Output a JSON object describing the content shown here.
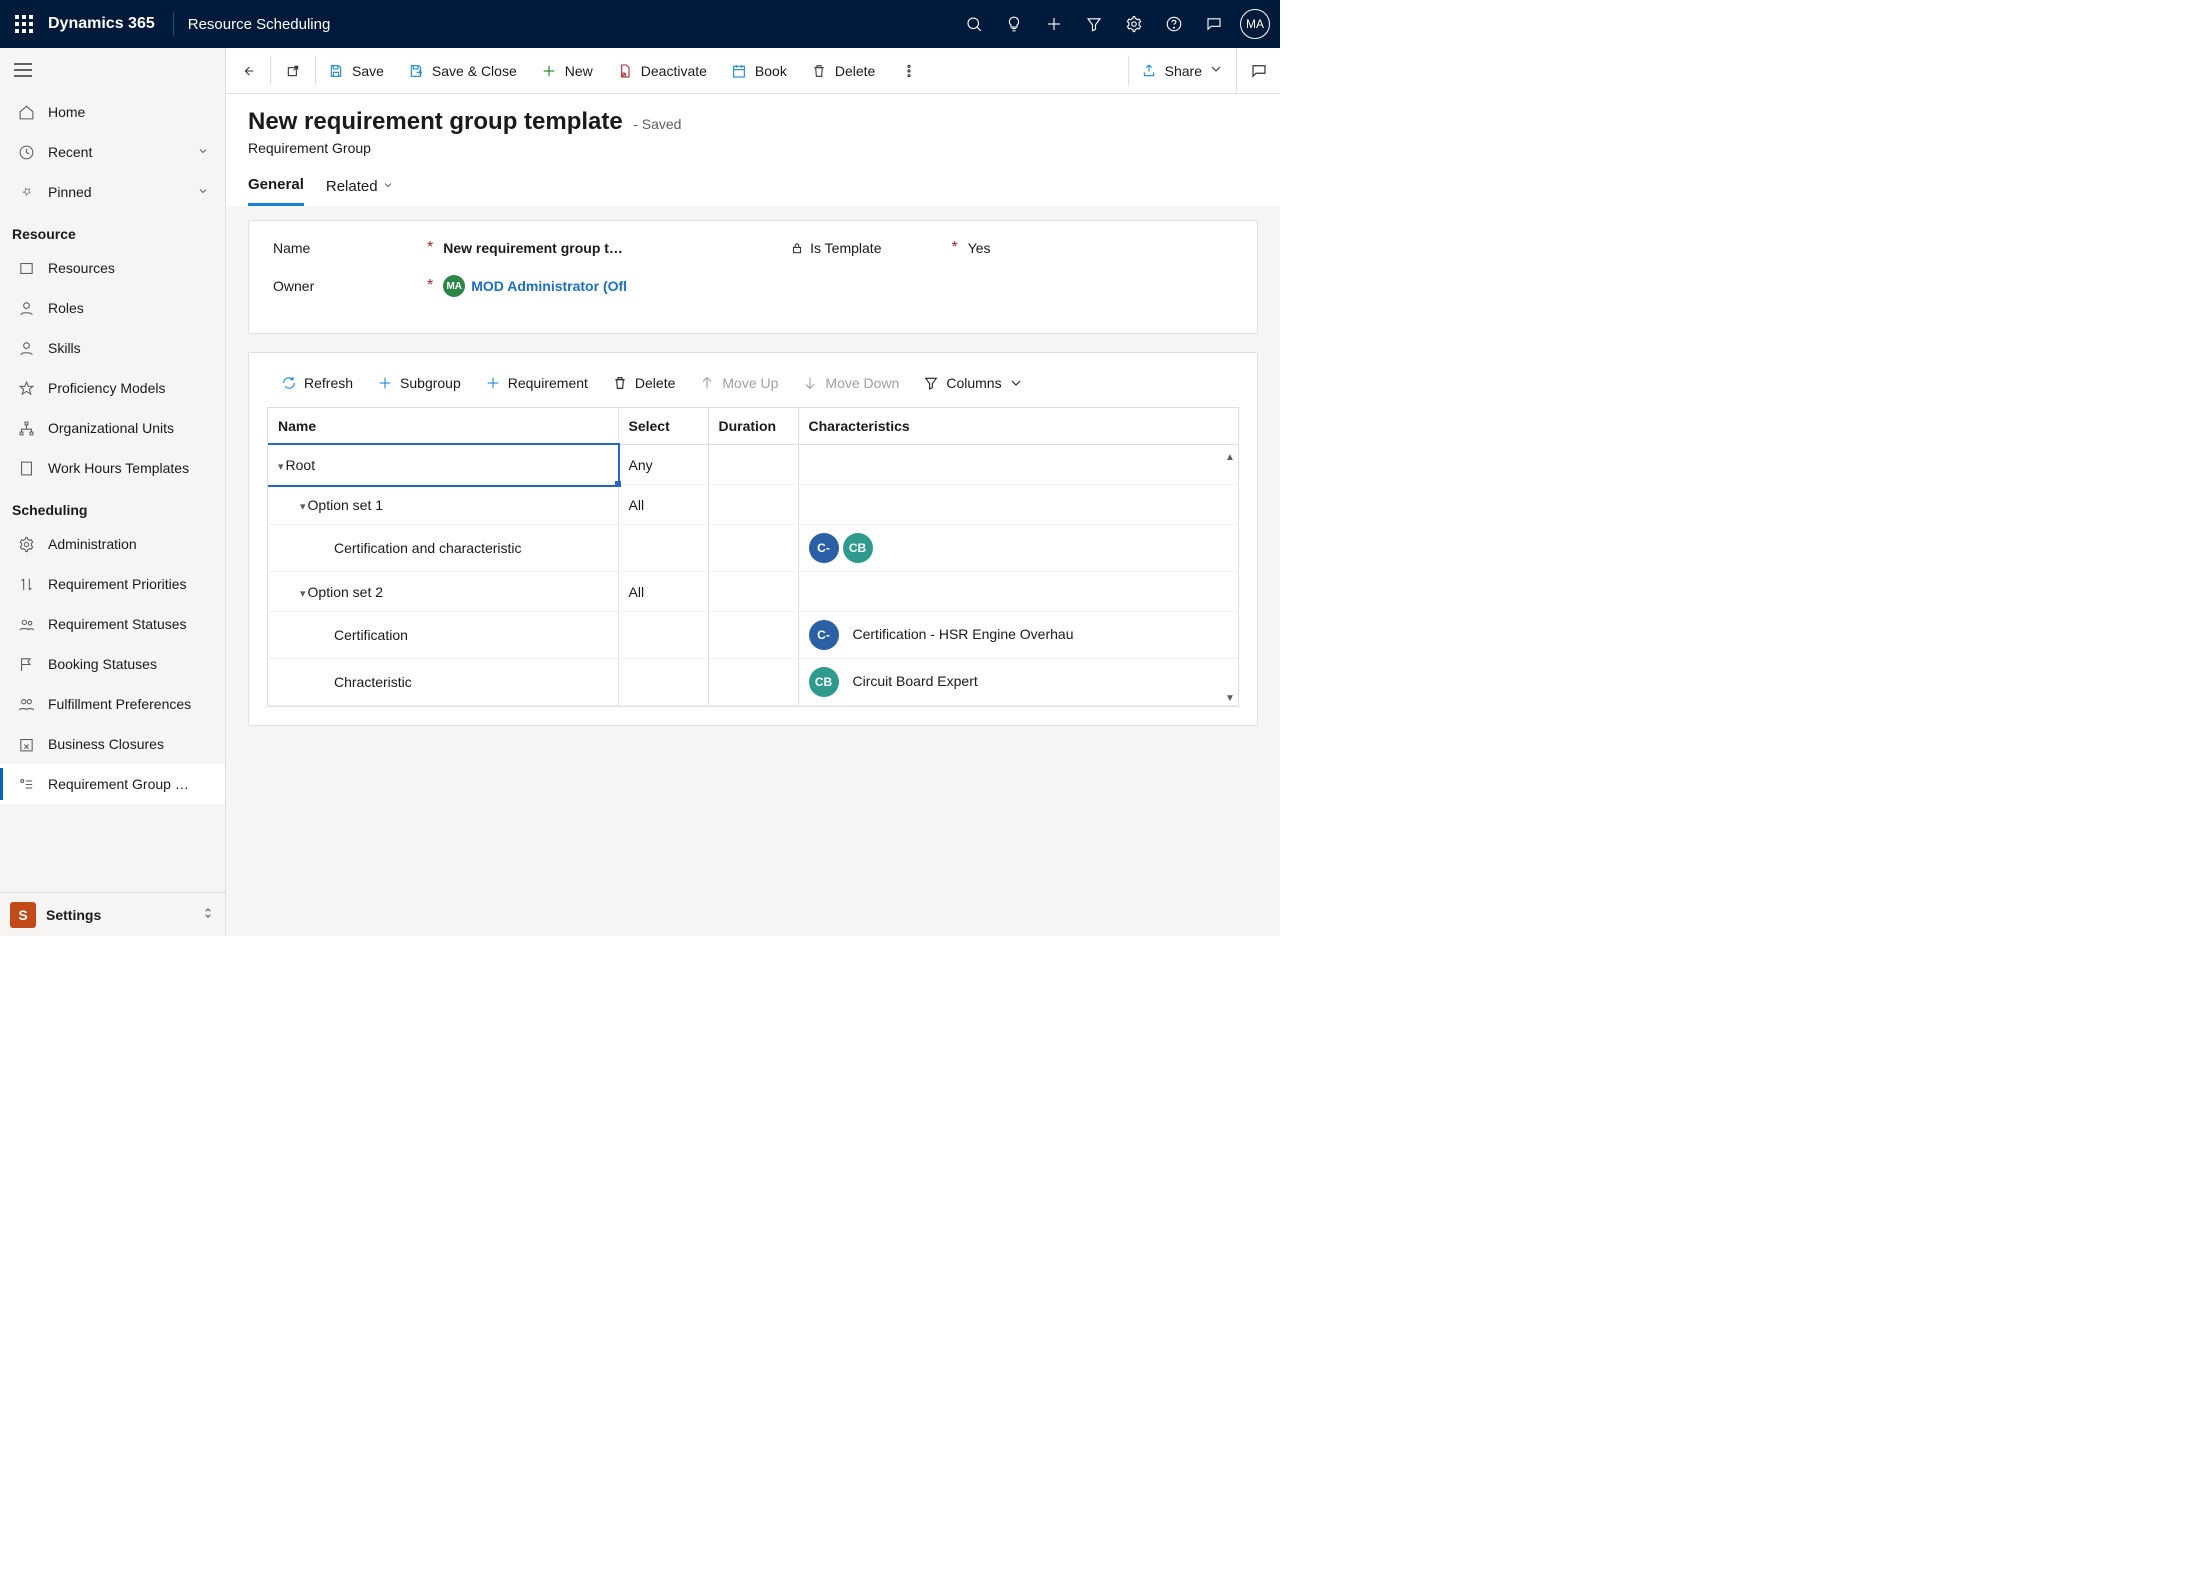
{
  "header": {
    "app_name": "Dynamics 365",
    "area_name": "Resource Scheduling",
    "avatar_initials": "MA"
  },
  "sidebar": {
    "top": [
      {
        "label": "Home"
      },
      {
        "label": "Recent",
        "has_chevron": true
      },
      {
        "label": "Pinned",
        "has_chevron": true
      }
    ],
    "section_resource": "Resource",
    "resource_items": [
      {
        "label": "Resources"
      },
      {
        "label": "Roles"
      },
      {
        "label": "Skills"
      },
      {
        "label": "Proficiency Models"
      },
      {
        "label": "Organizational Units"
      },
      {
        "label": "Work Hours Templates"
      }
    ],
    "section_scheduling": "Scheduling",
    "scheduling_items": [
      {
        "label": "Administration"
      },
      {
        "label": "Requirement Priorities"
      },
      {
        "label": "Requirement Statuses"
      },
      {
        "label": "Booking Statuses"
      },
      {
        "label": "Fulfillment Preferences"
      },
      {
        "label": "Business Closures"
      },
      {
        "label": "Requirement Group …",
        "active": true
      }
    ],
    "footer_badge": "S",
    "footer_label": "Settings"
  },
  "commandbar": {
    "save": "Save",
    "save_close": "Save & Close",
    "new": "New",
    "deactivate": "Deactivate",
    "book": "Book",
    "delete": "Delete",
    "share": "Share"
  },
  "form": {
    "title": "New requirement group template",
    "title_suffix": "- Saved",
    "entity": "Requirement Group",
    "tabs": {
      "general": "General",
      "related": "Related"
    },
    "fields": {
      "name_label": "Name",
      "name_value": "New requirement group t…",
      "template_label": "Is Template",
      "template_value": "Yes",
      "owner_label": "Owner",
      "owner_value": "MOD Administrator (Ofl",
      "owner_chip": "MA"
    }
  },
  "subgrid": {
    "toolbar": {
      "refresh": "Refresh",
      "subgroup": "Subgroup",
      "requirement": "Requirement",
      "delete": "Delete",
      "moveup": "Move Up",
      "movedown": "Move Down",
      "columns": "Columns"
    },
    "columns": {
      "name": "Name",
      "select": "Select",
      "duration": "Duration",
      "characteristics": "Characteristics"
    },
    "rows": [
      {
        "indent": 0,
        "name": "Root",
        "select": "Any",
        "chev": true,
        "selected": true
      },
      {
        "indent": 1,
        "name": "Option set 1",
        "select": "All",
        "chev": true
      },
      {
        "indent": 2,
        "name": "Certification and characteristic",
        "chips": [
          "C-",
          "CB"
        ]
      },
      {
        "indent": 1,
        "name": "Option set 2",
        "select": "All",
        "chev": true
      },
      {
        "indent": 2,
        "name": "Certification",
        "chips": [
          "C-"
        ],
        "char_text": "Certification - HSR Engine Overhau"
      },
      {
        "indent": 2,
        "name": "Chracteristic",
        "chips": [
          "CB"
        ],
        "chip_class": "c2",
        "char_text": "Circuit Board Expert"
      }
    ]
  }
}
